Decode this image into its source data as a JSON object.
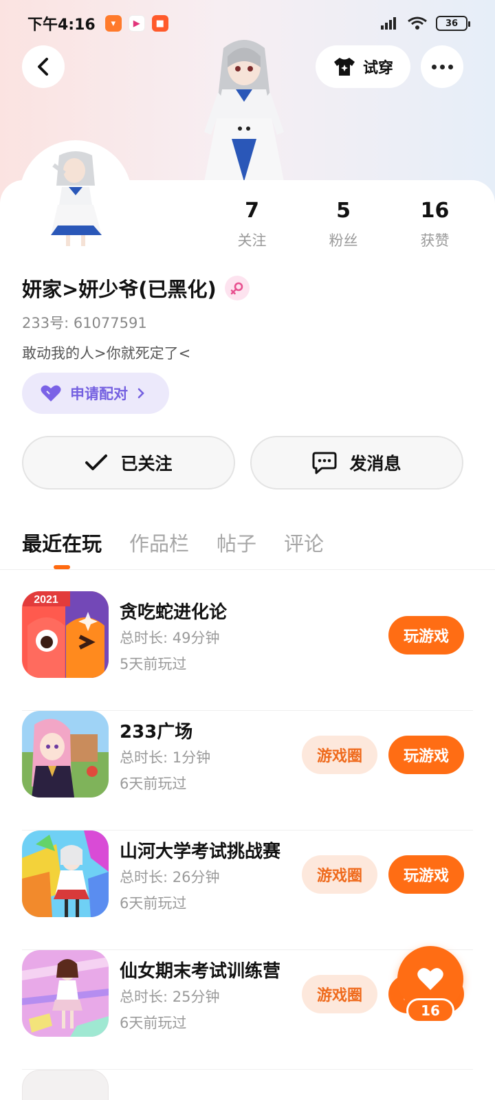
{
  "status_bar": {
    "time": "下午4:16",
    "battery": "36"
  },
  "header": {
    "tryon_label": "试穿"
  },
  "profile": {
    "stats": [
      {
        "num": "7",
        "label": "关注"
      },
      {
        "num": "5",
        "label": "粉丝"
      },
      {
        "num": "16",
        "label": "获赞"
      }
    ],
    "name": "妍家>妍少爷(已黑化)",
    "id": "233号: 61077591",
    "bio": "敢动我的人>你就死定了<",
    "pair_label": "申请配对",
    "follow_label": "已关注",
    "message_label": "发消息"
  },
  "tabs": [
    "最近在玩",
    "作品栏",
    "帖子",
    "评论"
  ],
  "games": [
    {
      "title": "贪吃蛇进化论",
      "time": "总时长: 49分钟",
      "last": "5天前玩过",
      "badge": "2021",
      "play": "玩游戏"
    },
    {
      "title": "233广场",
      "time": "总时长: 1分钟",
      "last": "6天前玩过",
      "circle": "游戏圈",
      "play": "玩游戏"
    },
    {
      "title": "山河大学考试挑战赛",
      "time": "总时长: 26分钟",
      "last": "6天前玩过",
      "circle": "游戏圈",
      "play": "玩游戏"
    },
    {
      "title": "仙女期末考试训练营",
      "time": "总时长: 25分钟",
      "last": "6天前玩过",
      "circle": "游戏圈",
      "play": "玩游戏"
    }
  ],
  "floating_like": {
    "count": "16"
  },
  "colors": {
    "accent": "#ff6d14",
    "pair": "#7460e0",
    "pink": "#e7508f"
  }
}
